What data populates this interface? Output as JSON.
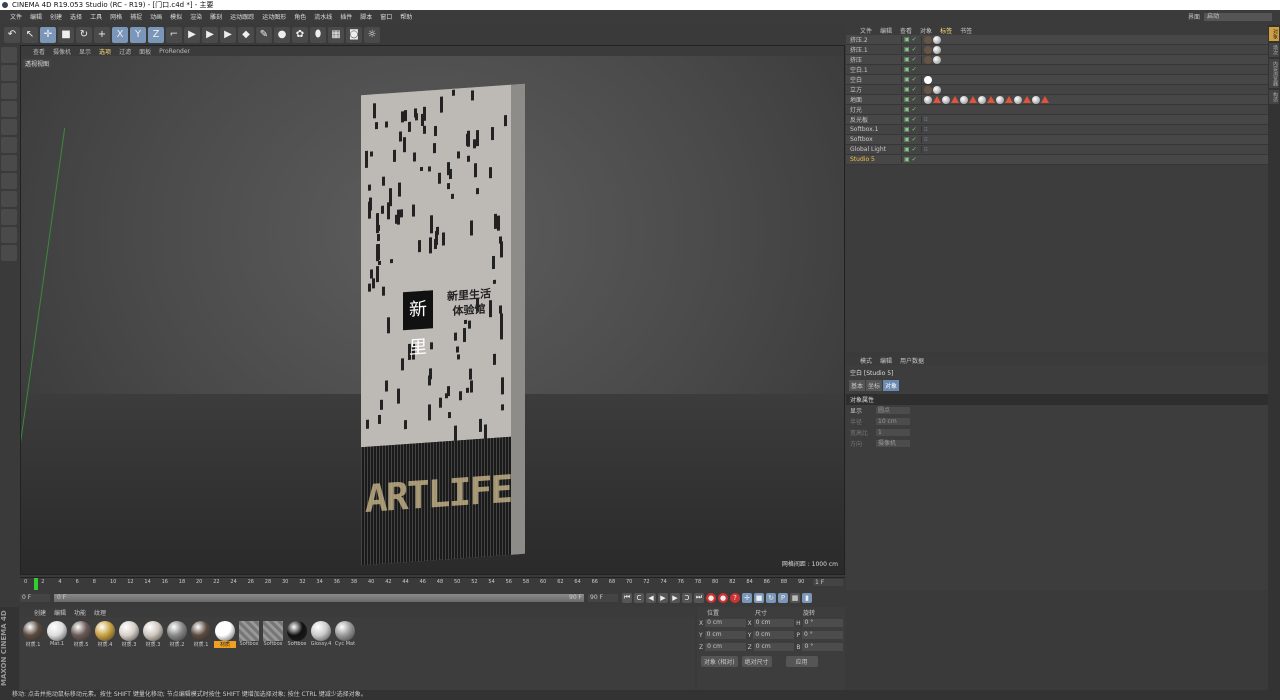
{
  "window": {
    "title": "CINEMA 4D R19.053 Studio (RC - R19) - [门口.c4d *] - 主要",
    "layout_label": "界面",
    "layout_value": "启动"
  },
  "menu": [
    "文件",
    "编辑",
    "创建",
    "选择",
    "工具",
    "网格",
    "捕捉",
    "动画",
    "模拟",
    "渲染",
    "雕刻",
    "运动跟踪",
    "运动图形",
    "角色",
    "流水线",
    "插件",
    "脚本",
    "窗口",
    "帮助"
  ],
  "toolbar": [
    {
      "icon": "undo-icon",
      "g": "↶"
    },
    {
      "icon": "select-icon",
      "g": "↖"
    },
    {
      "icon": "move-icon",
      "g": "✛",
      "on": true
    },
    {
      "icon": "scale-icon",
      "g": "■"
    },
    {
      "icon": "rotate-icon",
      "g": "↻"
    },
    {
      "icon": "add-icon",
      "g": "+"
    },
    {
      "icon": "x-axis-icon",
      "g": "X",
      "on": true
    },
    {
      "icon": "y-axis-icon",
      "g": "Y",
      "on": true
    },
    {
      "icon": "z-axis-icon",
      "g": "Z",
      "on": true
    },
    {
      "icon": "coordinate-system-icon",
      "g": "⌐"
    },
    {
      "icon": "render-view-icon",
      "g": "▶"
    },
    {
      "icon": "render-picture-viewer-icon",
      "g": "▶"
    },
    {
      "icon": "render-settings-icon",
      "g": "▶"
    },
    {
      "icon": "cube-icon",
      "g": "◆"
    },
    {
      "icon": "pen-icon",
      "g": "✎"
    },
    {
      "icon": "subdivision-icon",
      "g": "●"
    },
    {
      "icon": "array-icon",
      "g": "✿"
    },
    {
      "icon": "deformer-icon",
      "g": "⬮"
    },
    {
      "icon": "floor-icon",
      "g": "▦"
    },
    {
      "icon": "camera-icon",
      "g": "◙"
    },
    {
      "icon": "light-icon",
      "g": "☼"
    }
  ],
  "left_tools": [
    "make-editable-icon",
    "model-mode-icon",
    "texture-mode-icon",
    "workplane-icon",
    "points-mode-icon",
    "edges-mode-icon",
    "polygons-mode-icon",
    "axis-mode-icon",
    "tweak-icon",
    "snap-icon",
    "magnet-icon",
    "solo-icon"
  ],
  "viewport": {
    "menu": [
      "查看",
      "摄像机",
      "显示",
      "选项",
      "过滤",
      "面板",
      "ProRender"
    ],
    "active_menu": "选项",
    "label": "透视视图",
    "grid_label": "网格间距 : 1000 cm",
    "sign_text_1": "新里生活",
    "sign_text_2": "体验馆",
    "logo_text": "新里",
    "led_text": "ARTLIFE"
  },
  "object_manager": {
    "menu": [
      "文件",
      "编辑",
      "查看",
      "对象",
      "标签",
      "书签"
    ],
    "active_menu": "标签",
    "objects": [
      {
        "name": "挤压.2",
        "tags": "ab"
      },
      {
        "name": "挤压.1",
        "tags": "ab"
      },
      {
        "name": "挤压",
        "tags": "ab"
      },
      {
        "name": "空白.1",
        "tags": ""
      },
      {
        "name": "空白",
        "tags": "w"
      },
      {
        "name": "立方",
        "tags": "ab"
      },
      {
        "name": "地面",
        "tags": "floor"
      },
      {
        "name": "灯光",
        "tags": ""
      },
      {
        "name": "反光板",
        "tags": "d"
      },
      {
        "name": "Softbox.1",
        "tags": "d"
      },
      {
        "name": "Softbox",
        "tags": "d"
      },
      {
        "name": "Global Light",
        "tags": "d"
      },
      {
        "name": "Studio 5",
        "tags": "",
        "highlight": true
      }
    ]
  },
  "side_tabs": [
    "对象",
    "场次",
    "内容浏览器",
    "构造"
  ],
  "attributes": {
    "menu": [
      "模式",
      "编辑",
      "用户数据"
    ],
    "title": "空白 [Studio 5]",
    "tabs": [
      "基本",
      "坐标",
      "对象"
    ],
    "active_tab": "对象",
    "section": "对象属性",
    "fields": [
      {
        "label": "显示",
        "value": "圆点",
        "enabled": true
      },
      {
        "label": "半径",
        "value": "10 cm",
        "enabled": false
      },
      {
        "label": "宽高比",
        "value": "1",
        "enabled": false
      },
      {
        "label": "方向",
        "value": "摄像机",
        "enabled": false
      }
    ]
  },
  "timeline": {
    "ticks": [
      0,
      2,
      4,
      6,
      8,
      10,
      12,
      14,
      16,
      18,
      20,
      22,
      24,
      26,
      28,
      30,
      32,
      34,
      36,
      38,
      40,
      42,
      44,
      46,
      48,
      50,
      52,
      54,
      56,
      58,
      60,
      62,
      64,
      66,
      68,
      70,
      72,
      74,
      76,
      78,
      80,
      82,
      84,
      86,
      88,
      90
    ],
    "current_frame": "1 F",
    "start": "0 F",
    "slider_start": "0 F",
    "slider_end": "90 F",
    "end": "90 F"
  },
  "materials": {
    "menu": [
      "创建",
      "编辑",
      "功能",
      "纹理"
    ],
    "items": [
      {
        "name": "材质.1",
        "color": "#5a4a40"
      },
      {
        "name": "Mat.1",
        "color": "#ddd"
      },
      {
        "name": "材质.5",
        "color": "#6a5a55"
      },
      {
        "name": "材质.4",
        "color": "#c8a040"
      },
      {
        "name": "材质.3",
        "color": "#d8d0c8"
      },
      {
        "name": "材质.3",
        "color": "#d0c8c0"
      },
      {
        "name": "材质.2",
        "color": "#888"
      },
      {
        "name": "材质.1",
        "color": "#5a4a40"
      },
      {
        "name": "材质",
        "color": "#ffffff",
        "selected": true
      },
      {
        "name": "Softbox",
        "color": "stripe"
      },
      {
        "name": "Softbox",
        "color": "stripe"
      },
      {
        "name": "Softbox",
        "color": "#111"
      },
      {
        "name": "Glossy.4",
        "color": "#ccc"
      },
      {
        "name": "Cyc Mat",
        "color": "#999"
      }
    ]
  },
  "coordinates": {
    "headers": [
      "位置",
      "尺寸",
      "旋转"
    ],
    "rows": [
      {
        "a": "X",
        "pos": "0 cm",
        "b": "X",
        "size": "0 cm",
        "c": "H",
        "rot": "0 °"
      },
      {
        "a": "Y",
        "pos": "0 cm",
        "b": "Y",
        "size": "0 cm",
        "c": "P",
        "rot": "0 °"
      },
      {
        "a": "Z",
        "pos": "0 cm",
        "b": "Z",
        "size": "0 cm",
        "c": "B",
        "rot": "0 °"
      }
    ],
    "mode": "对象 (相对)",
    "size_mode": "绝对尺寸",
    "apply": "应用"
  },
  "brand": "MAXON CINEMA 4D",
  "status": "移动: 点击并拖动鼠标移动元素。按住 SHIFT 键量化移动; 节点编辑模式时按住 SHIFT 键增加选择对象; 按住 CTRL 键减少选择对象。"
}
